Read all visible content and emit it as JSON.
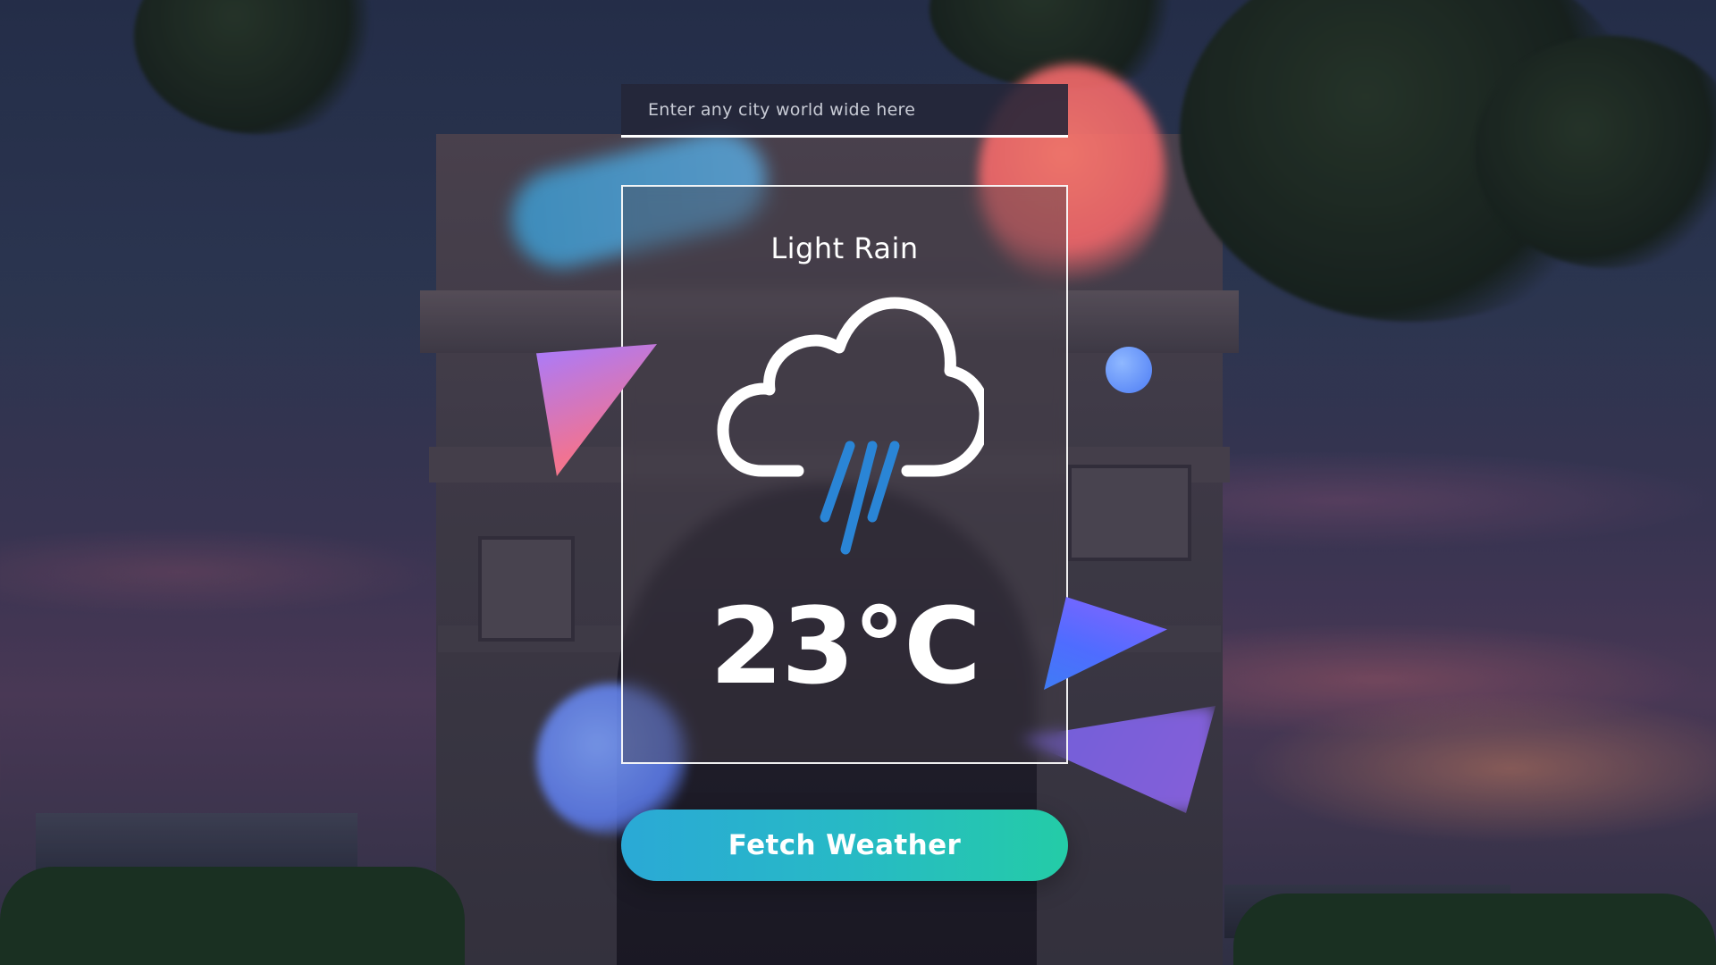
{
  "search": {
    "placeholder": "Enter any city world wide here",
    "value": ""
  },
  "weather": {
    "condition": "Light Rain",
    "temperature": "23°C",
    "icon": "cloud-rain-icon"
  },
  "actions": {
    "fetch_label": "Fetch Weather"
  },
  "colors": {
    "button_gradient_start": "#2aa9d6",
    "button_gradient_end": "#24cca7",
    "rain_streaks": "#2a85d6",
    "cloud_outline": "#ffffff",
    "card_border": "#ffffff"
  }
}
